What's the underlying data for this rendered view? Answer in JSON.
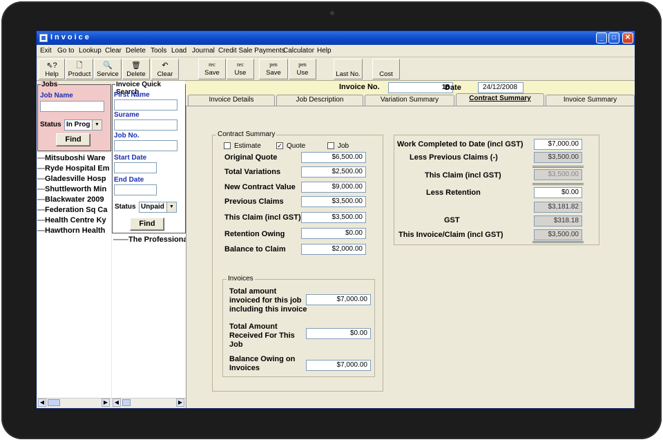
{
  "window": {
    "title": "Invoice"
  },
  "menu": [
    "Exit",
    "Go to",
    "Lookup",
    "Clear",
    "Delete",
    "Tools",
    "Load",
    "Journal",
    "Credit Sale Payments",
    "Calculator",
    "Help"
  ],
  "toolbar": {
    "help": "Help",
    "product": "Product",
    "service": "Service",
    "delete": "Delete",
    "clear": "Clear",
    "rec_save_top": "rec",
    "rec_save": "Save",
    "rec_use_top": "rec",
    "rec_use": "Use",
    "pen_save_top": "pen",
    "pen_save": "Save",
    "pen_use_top": "pen",
    "pen_use": "Use",
    "last_no": "Last No.",
    "cost": "Cost"
  },
  "jobs_panel": {
    "legend": "Jobs",
    "job_name_label": "Job Name",
    "job_name_value": "",
    "status_label": "Status",
    "status_value": "In Prog",
    "find": "Find"
  },
  "job_list": [
    "Mitsuboshi Ware",
    "Ryde Hospital Em",
    "Gladesville Hosp",
    "Shuttleworth Min",
    "Blackwater 2009",
    "Federation Sq Ca",
    "Health Centre Ky",
    "Hawthorn Health"
  ],
  "quick_search": {
    "legend": "Invoice Quick Search",
    "first_name": "First Name",
    "surname": "Surame",
    "job_no": "Job No.",
    "start_date": "Start Date",
    "end_date": "End Date",
    "status_label": "Status",
    "status_value": "Unpaid",
    "find": "Find",
    "tree_item": "The Professional"
  },
  "header": {
    "invoice_no_label": "Invoice No.",
    "invoice_no": "18",
    "date_label": "Date",
    "date": "24/12/2008"
  },
  "tabs": [
    "Invoice Details",
    "Job Description",
    "Variation Summary",
    "Contract Summary",
    "Invoice Summary"
  ],
  "active_tab": "Contract Summary",
  "contract_summary": {
    "legend": "Contract Summary",
    "estimate": "Estimate",
    "estimate_checked": false,
    "quote": "Quote",
    "quote_checked": true,
    "job": "Job",
    "job_checked": false,
    "rows": [
      {
        "label": "Original Quote",
        "value": "$6,500.00"
      },
      {
        "label": "Total Variations",
        "value": "$2,500.00"
      },
      {
        "label": "New Contract Value",
        "value": "$9,000.00"
      },
      {
        "label": "Previous Claims",
        "value": "$3,500.00"
      },
      {
        "label": "This Claim (incl GST)",
        "value": "$3,500.00"
      },
      {
        "label": "Retention Owing",
        "value": "$0.00"
      },
      {
        "label": "Balance to Claim",
        "value": "$2,000.00"
      }
    ]
  },
  "invoices_box": {
    "legend": "Invoices",
    "total_invoiced_label": "Total amount invoiced for this job including this invoice",
    "total_invoiced": "$7,000.00",
    "total_received_label": "Total Amount Received For This Job",
    "total_received": "$0.00",
    "balance_owing_label": "Balance Owing on Invoices",
    "balance_owing": "$7,000.00"
  },
  "claim_summary": {
    "work_completed_label": "Work Completed to Date (incl GST)",
    "work_completed": "$7,000.00",
    "less_previous_label": "Less Previous Claims (-)",
    "less_previous": "$3,500.00",
    "this_claim_label": "This Claim (incl GST)",
    "this_claim": "$3,500.00",
    "less_retention_label": "Less Retention",
    "less_retention": "$0.00",
    "subtotal": "$3,181.82",
    "gst_label": "GST",
    "gst": "$318.18",
    "this_invoice_label": "This Invoice/Claim (incl GST)",
    "this_invoice": "$3,500.00"
  }
}
